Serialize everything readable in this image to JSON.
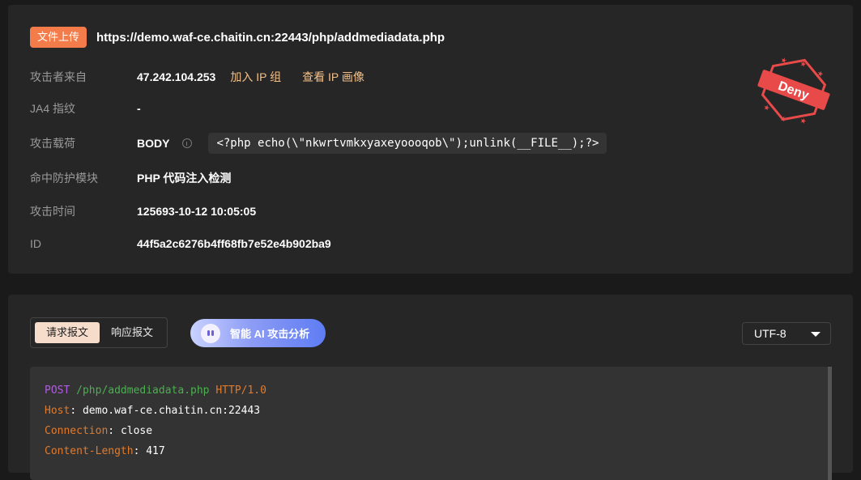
{
  "event": {
    "tag": "文件上传",
    "url": "https://demo.waf-ce.chaitin.cn:22443/php/addmediadata.php"
  },
  "details": {
    "attacker": {
      "label": "攻击者来自",
      "value": "47.242.104.253",
      "add_ip_group": "加入 IP 组",
      "view_ip_profile": "查看 IP 画像"
    },
    "ja4": {
      "label": "JA4 指纹",
      "value": "-"
    },
    "payload": {
      "label": "攻击载荷",
      "location": "BODY",
      "content": "<?php echo(\\\"nkwrtvmkxyaxeyoooqob\\\");unlink(__FILE__);?>"
    },
    "module": {
      "label": "命中防护模块",
      "value": "PHP 代码注入检测"
    },
    "time": {
      "label": "攻击时间",
      "value": "125693-10-12 10:05:05"
    },
    "id": {
      "label": "ID",
      "value": "44f5a2c6276b4ff68fb7e52e4b902ba9"
    }
  },
  "stamp": {
    "text": "Deny",
    "color": "#e84a4a"
  },
  "tabs": {
    "request": "请求报文",
    "response": "响应报文",
    "active": "request"
  },
  "ai_button": {
    "label": "智能 AI 攻击分析"
  },
  "encoding": {
    "selected": "UTF-8"
  },
  "request": {
    "method": "POST",
    "path": "/php/addmediadata.php",
    "protocol": "HTTP/1.0",
    "headers": [
      {
        "key": "Host",
        "value": "demo.waf-ce.chaitin.cn:22443"
      },
      {
        "key": "Connection",
        "value": "close"
      },
      {
        "key": "Content-Length",
        "value": "417"
      }
    ]
  },
  "colors": {
    "accent": "#f47c4a",
    "link": "#f3c08a",
    "background": "#1a1a1a",
    "panel": "#262626"
  }
}
